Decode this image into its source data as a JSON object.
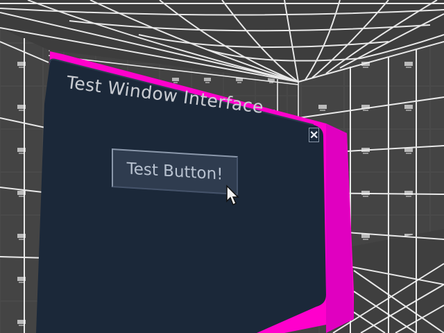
{
  "window": {
    "title": "Test Window Interface",
    "background_color": "#1b2839",
    "frame_color": "#ff00cc"
  },
  "close_button": {
    "label": "✕",
    "icon": "close-icon"
  },
  "test_button": {
    "label": "Test Button!"
  },
  "cursor": {
    "icon": "mouse-pointer-icon"
  },
  "environment": {
    "floor_color": "#3a3a3a",
    "grid_line_color": "#ffffff",
    "tile_logo_text": "ikov"
  }
}
